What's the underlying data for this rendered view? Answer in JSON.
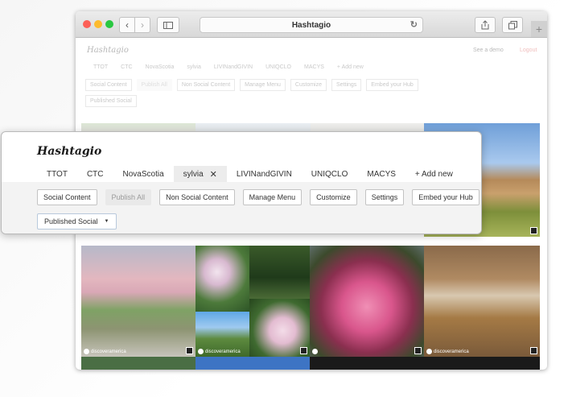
{
  "browser": {
    "url_title": "Hashtagio",
    "icons": [
      "back-arrow",
      "forward-arrow",
      "sidebar-icon",
      "reload-icon",
      "share-icon",
      "tabs-icon",
      "plus-icon"
    ],
    "back_glyph": "‹",
    "forward_glyph": "›",
    "plus_glyph": "+"
  },
  "background_page": {
    "logo": "Hashtagio",
    "see_demo": "See a demo",
    "logout": "Logout",
    "tabs": [
      "TTOT",
      "CTC",
      "NovaScotia",
      "sylvia",
      "LIVINandGIVIN",
      "UNIQCLO",
      "MACYS",
      "+ Add new"
    ],
    "buttons": [
      "Social Content",
      "Publish All",
      "Non Social Content",
      "Manage Menu",
      "Customize",
      "Settings",
      "Embed your Hub"
    ],
    "select": "Published Social",
    "credits": [
      "discoveramerica",
      "discoveramerica",
      "discoveramerica",
      "discoveramerica"
    ]
  },
  "panel": {
    "logo": "Hashtagio",
    "tabs": [
      {
        "label": "TTOT"
      },
      {
        "label": "CTC"
      },
      {
        "label": "NovaScotia"
      },
      {
        "label": "sylvia",
        "active": true,
        "close": "✕"
      },
      {
        "label": "LIVINandGIVIN"
      },
      {
        "label": "UNIQCLO"
      },
      {
        "label": "MACYS"
      },
      {
        "label": "+ Add new"
      }
    ],
    "buttons": {
      "social_content": "Social Content",
      "publish_all": "Publish All",
      "non_social_content": "Non Social Content",
      "manage_menu": "Manage Menu",
      "customize": "Customize",
      "settings": "Settings",
      "embed_hub": "Embed your Hub"
    },
    "select": {
      "value": "Published Social",
      "caret": "▼"
    }
  },
  "colors": {
    "logout": "#d0312d",
    "active_tab": "#ececec",
    "strip": "#f3f3f3"
  }
}
